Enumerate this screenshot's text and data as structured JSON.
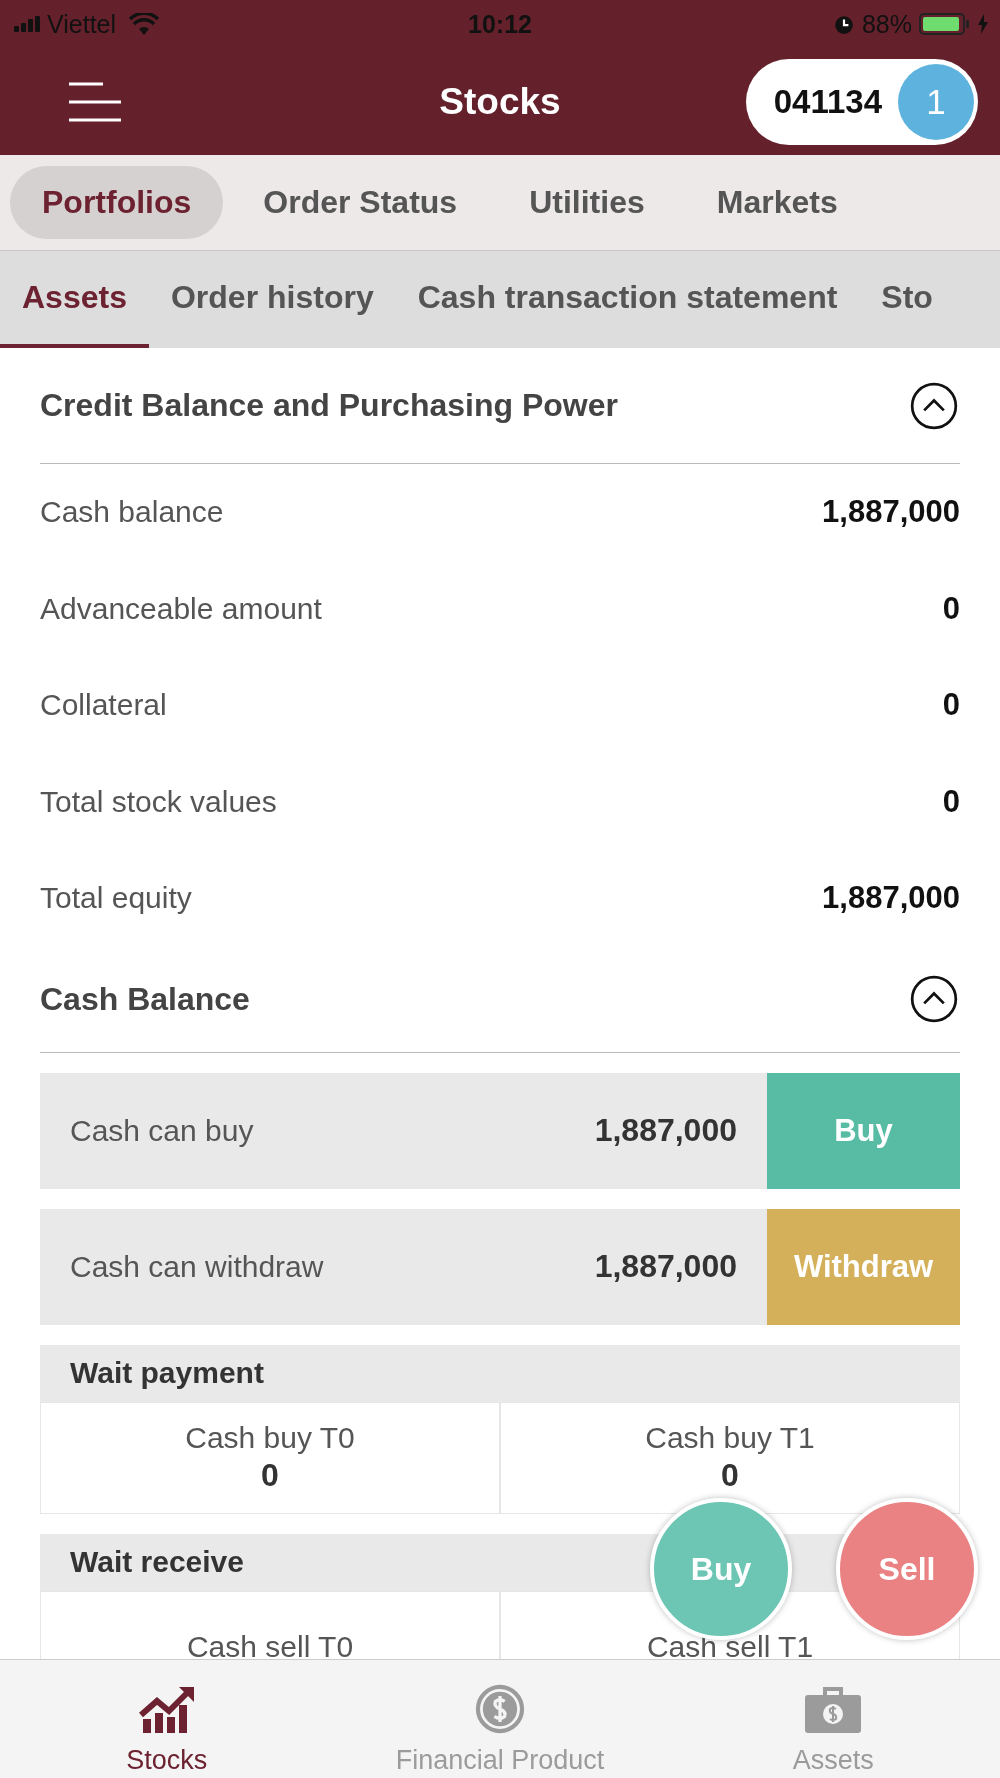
{
  "status_bar": {
    "carrier": "Viettel",
    "time": "10:12",
    "battery": "88%"
  },
  "header": {
    "title": "Stocks",
    "account": "041134",
    "badge": "1"
  },
  "tabs": [
    {
      "label": "Portfolios",
      "selected": true
    },
    {
      "label": "Order Status",
      "selected": false
    },
    {
      "label": "Utilities",
      "selected": false
    },
    {
      "label": "Markets",
      "selected": false
    }
  ],
  "subtabs": [
    {
      "label": "Assets",
      "selected": true
    },
    {
      "label": "Order history",
      "selected": false
    },
    {
      "label": "Cash transaction statement",
      "selected": false
    },
    {
      "label": "Sto",
      "selected": false
    }
  ],
  "credit_section": {
    "title": "Credit Balance and Purchasing Power",
    "expanded": true,
    "rows": [
      {
        "label": "Cash balance",
        "value": "1,887,000"
      },
      {
        "label": "Advanceable amount",
        "value": "0"
      },
      {
        "label": "Collateral",
        "value": "0"
      },
      {
        "label": "Total stock values",
        "value": "0"
      },
      {
        "label": "Total equity",
        "value": "1,887,000"
      }
    ]
  },
  "cash_section": {
    "title": "Cash Balance",
    "expanded": true,
    "actions": [
      {
        "label": "Cash can buy",
        "value": "1,887,000",
        "button": "Buy",
        "kind": "buy"
      },
      {
        "label": "Cash can withdraw",
        "value": "1,887,000",
        "button": "Withdraw",
        "kind": "withdraw"
      }
    ],
    "groups": [
      {
        "title": "Wait payment",
        "cells": [
          {
            "label": "Cash buy T0",
            "value": "0"
          },
          {
            "label": "Cash buy T1",
            "value": "0"
          }
        ]
      },
      {
        "title": "Wait receive",
        "cells": [
          {
            "label": "Cash sell T0"
          },
          {
            "label": "Cash sell T1"
          }
        ]
      }
    ]
  },
  "fabs": [
    {
      "label": "Buy",
      "kind": "buy"
    },
    {
      "label": "Sell",
      "kind": "sell"
    }
  ],
  "bottom_nav": [
    {
      "label": "Stocks",
      "selected": true,
      "kind": "chart"
    },
    {
      "label": "Financial Product",
      "selected": false,
      "kind": "coin"
    },
    {
      "label": "Assets",
      "selected": false,
      "kind": "briefcase"
    }
  ]
}
